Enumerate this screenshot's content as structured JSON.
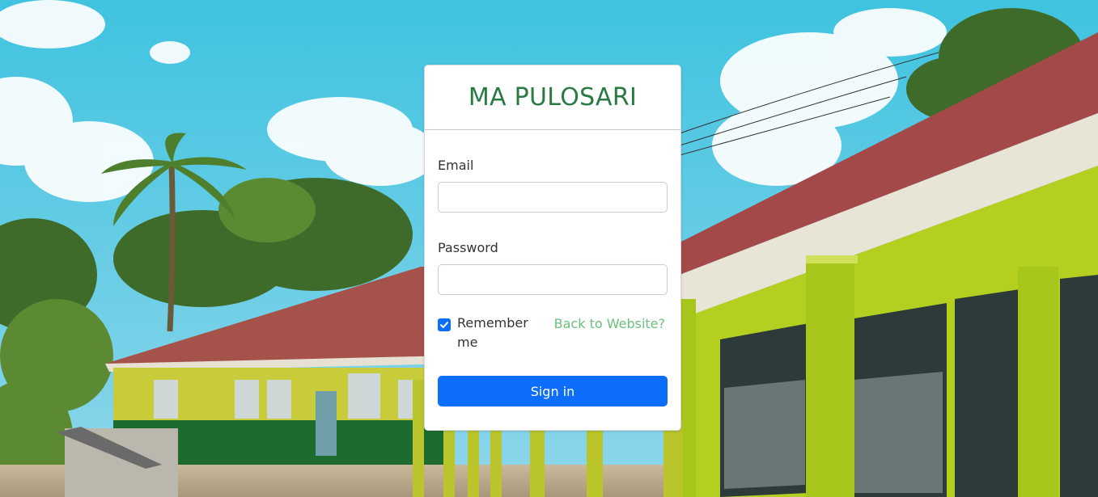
{
  "brand": {
    "title": "MA PULOSARI"
  },
  "form": {
    "email_label": "Email",
    "email_value": "",
    "password_label": "Password",
    "password_value": "",
    "remember_label": "Remember me",
    "remember_checked": true,
    "back_link": "Back to Website?",
    "submit_label": "Sign in"
  },
  "colors": {
    "brand_green": "#2a7a43",
    "link_green": "#6cbf7f",
    "primary_blue": "#0d6efd"
  },
  "background": {
    "icon": "school-building-photo"
  }
}
